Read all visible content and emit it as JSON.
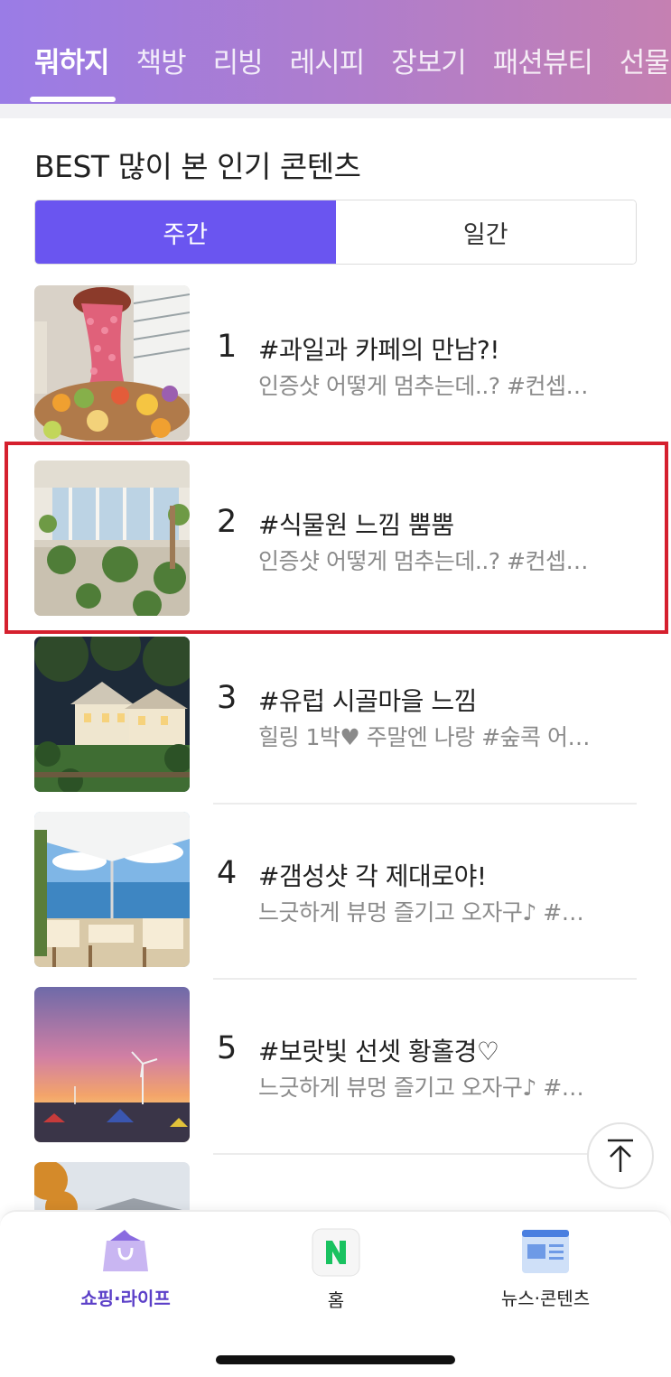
{
  "top_tabs": [
    "뭐하지",
    "책방",
    "리빙",
    "레시피",
    "장보기",
    "패션뷰티",
    "선물"
  ],
  "active_tab": "뭐하지",
  "section_title": "BEST 많이 본 인기 콘텐츠",
  "segment": {
    "weekly": "주간",
    "daily": "일간",
    "selected": "주간"
  },
  "items": [
    {
      "rank": "1",
      "title": "#과일과 카페의 만남?!",
      "subtitle": "인증샷 어떻게 멈추는데..? #컨셉…"
    },
    {
      "rank": "2",
      "title": "#식물원 느낌 뿜뿜",
      "subtitle": "인증샷 어떻게 멈추는데..? #컨셉…"
    },
    {
      "rank": "3",
      "title": "#유럽 시골마을 느낌",
      "subtitle": "힐링 1박♥ 주말엔 나랑 #숲콕 어…"
    },
    {
      "rank": "4",
      "title": "#갬성샷 각 제대로야!",
      "subtitle": "느긋하게 뷰멍 즐기고 오자구♪ #…"
    },
    {
      "rank": "5",
      "title": "#보랏빛 선셋 황홀경♡",
      "subtitle": "느긋하게 뷰멍 즐기고 오자구♪ #…"
    }
  ],
  "bottom_nav": [
    {
      "label": "쇼핑·라이프",
      "icon": "shopping-bag-icon",
      "active": true
    },
    {
      "label": "홈",
      "icon": "naver-home-icon",
      "active": false
    },
    {
      "label": "뉴스·콘텐츠",
      "icon": "news-icon",
      "active": false
    }
  ],
  "colors": {
    "accent": "#6a55f0",
    "highlight": "#d5202e",
    "active_nav": "#5b3fc8"
  }
}
